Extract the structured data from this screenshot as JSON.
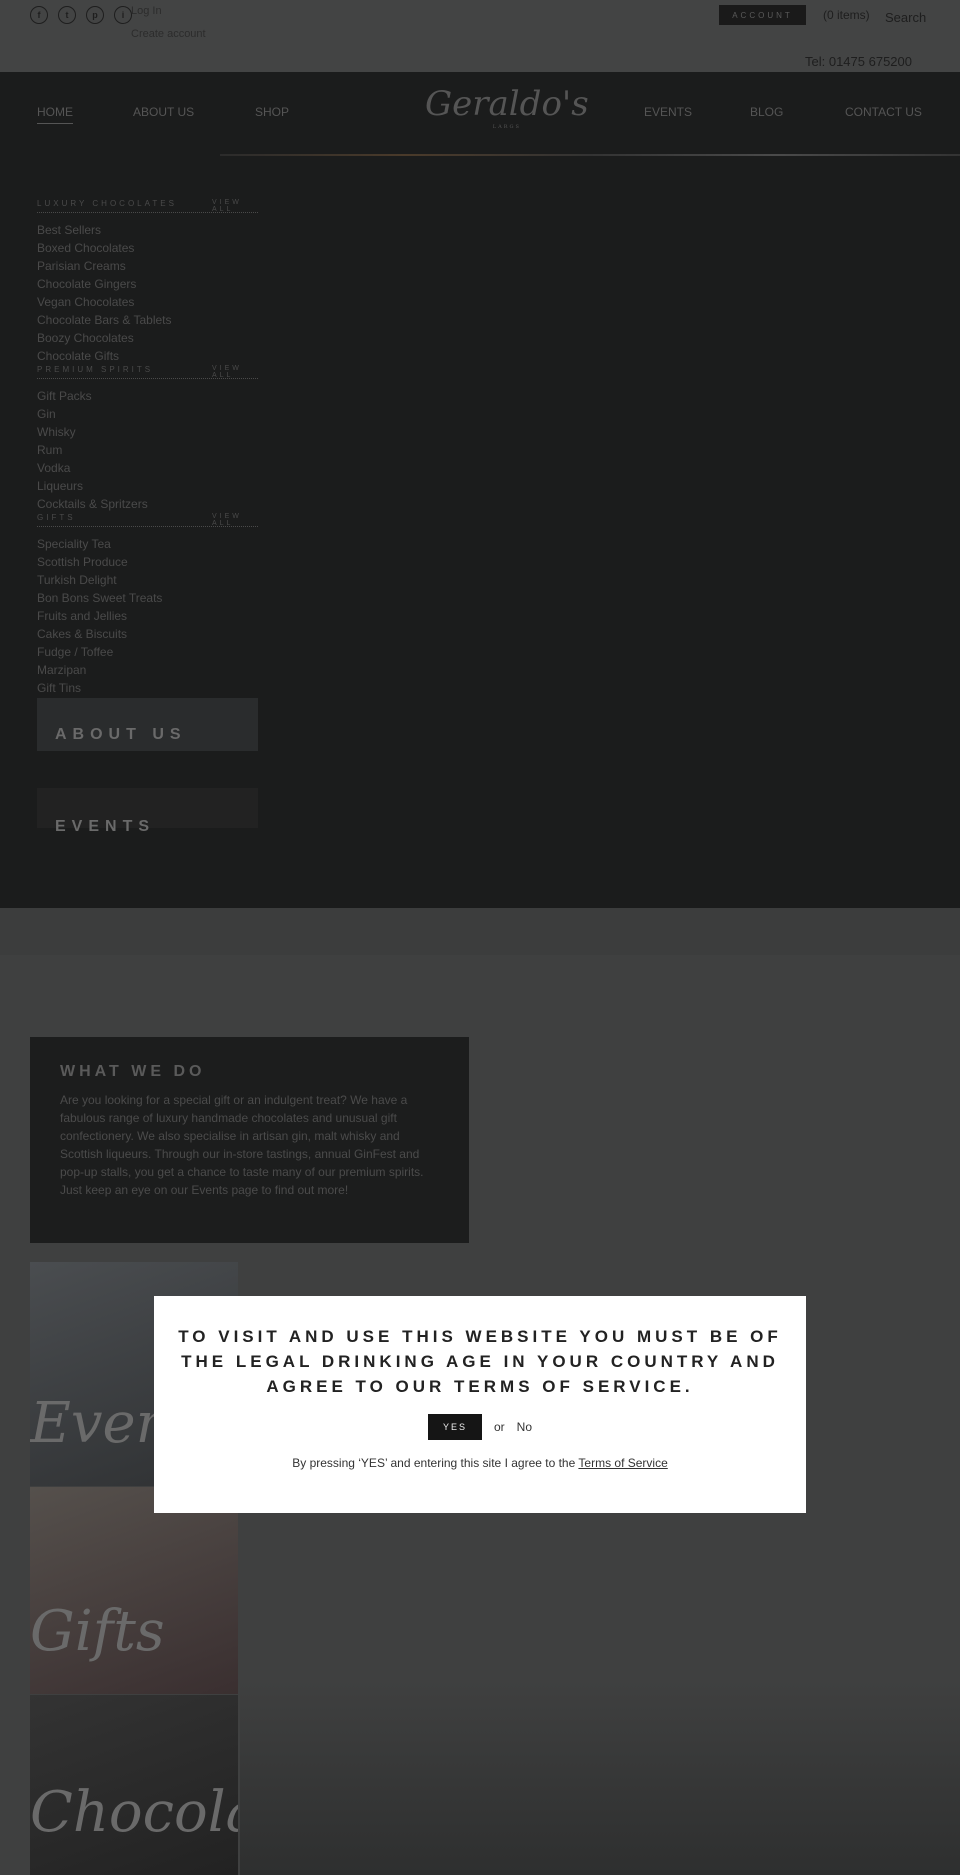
{
  "topbar": {
    "social": [
      "f",
      "t",
      "p",
      "i"
    ],
    "login": "Log In",
    "create_account": "Create account",
    "account": "ACCOUNT",
    "cart": "(0 items)",
    "search": "Search",
    "tel": "Tel: 01475 675200"
  },
  "nav": {
    "left": [
      "HOME",
      "ABOUT US",
      "SHOP"
    ],
    "right": [
      "EVENTS",
      "BLOG",
      "CONTACT US"
    ],
    "logo": "Geraldo's",
    "logo_sub": "LARGS"
  },
  "menu": [
    {
      "title": "LUXURY CHOCOLATES",
      "view_all": "VIEW ALL",
      "items": [
        "Best Sellers",
        "Boxed Chocolates",
        "Parisian Creams",
        "Chocolate Gingers",
        "Vegan Chocolates",
        "Chocolate Bars & Tablets",
        "Boozy Chocolates",
        "Chocolate Gifts"
      ]
    },
    {
      "title": "PREMIUM SPIRITS",
      "view_all": "VIEW ALL",
      "items": [
        "Gift Packs",
        "Gin",
        "Whisky",
        "Rum",
        "Vodka",
        "Liqueurs",
        "Cocktails & Spritzers"
      ]
    },
    {
      "title": "GIFTS",
      "view_all": "VIEW ALL",
      "items": [
        "Speciality Tea",
        "Scottish Produce",
        "Turkish Delight",
        "Bon Bons Sweet Treats",
        "Fruits and Jellies",
        "Cakes & Biscuits",
        "Fudge / Toffee",
        "Marzipan",
        "Gift Tins"
      ]
    }
  ],
  "tiles": {
    "about": "ABOUT US",
    "events": "EVENTS"
  },
  "what_we_do": {
    "title": "WHAT WE DO",
    "body": "Are you looking for a special gift or an indulgent treat? We have a fabulous range of luxury handmade chocolates and unusual gift confectionery. We also specialise in artisan gin, malt whisky and Scottish liqueurs. Through our in-store tastings, annual GinFest and pop-up stalls, you get a chance to taste many of our premium spirits. Just keep an eye on our Events page to find out more!"
  },
  "images": [
    "Events",
    "Gifts",
    "Chocolate"
  ],
  "modal": {
    "heading": "TO VISIT AND USE THIS WEBSITE YOU MUST BE OF THE LEGAL DRINKING AGE IN YOUR COUNTRY AND AGREE TO OUR TERMS OF SERVICE.",
    "yes": "YES",
    "or": "or",
    "no": "No",
    "note": "By pressing ‘YES’ and entering this site I agree to the ",
    "terms_link": "Terms of Service"
  }
}
